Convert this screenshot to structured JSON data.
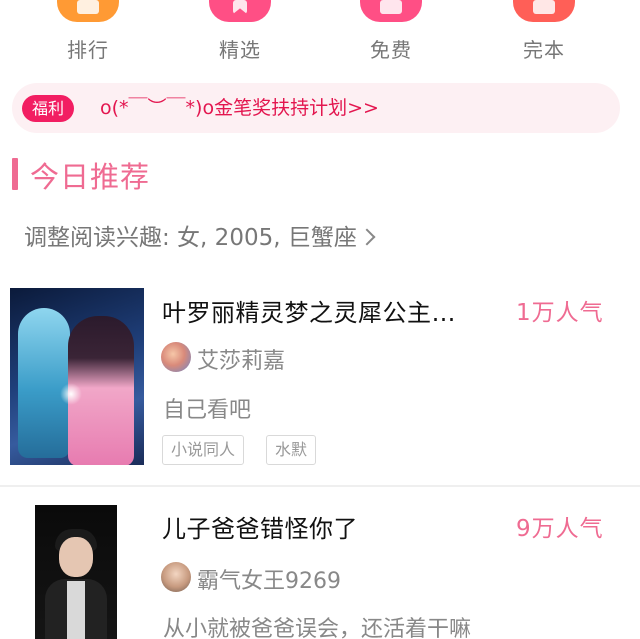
{
  "categories": [
    {
      "label": "排行",
      "icon": "ranking-icon"
    },
    {
      "label": "精选",
      "icon": "bookmark-icon"
    },
    {
      "label": "免费",
      "icon": "free-icon"
    },
    {
      "label": "完本",
      "icon": "complete-icon"
    }
  ],
  "banner": {
    "badge": "福利",
    "text": "o(*￣︶￣*)o金笔奖扶持计划>>"
  },
  "section": {
    "title": "今日推荐",
    "interest": "调整阅读兴趣: 女, 2005, 巨蟹座"
  },
  "books": [
    {
      "title": "叶罗丽精灵梦之灵犀公主…",
      "popularity": "1万人气",
      "author": "艾莎莉嘉",
      "description": "自己看吧",
      "tags": [
        "小说同人",
        "水默"
      ]
    },
    {
      "title": "儿子爸爸错怪你了",
      "popularity": "9万人气",
      "author": "霸气女王9269",
      "description": "从小就被爸爸误会，还活着干嘛",
      "tags": []
    }
  ],
  "colors": {
    "accent_pink": "#ef6b92",
    "badge_red": "#f21e62",
    "banner_bg": "#fdf0f3",
    "icon_orange": "#ff9a34",
    "icon_pink": "#ff4f85",
    "icon_red": "#ff5f57"
  }
}
